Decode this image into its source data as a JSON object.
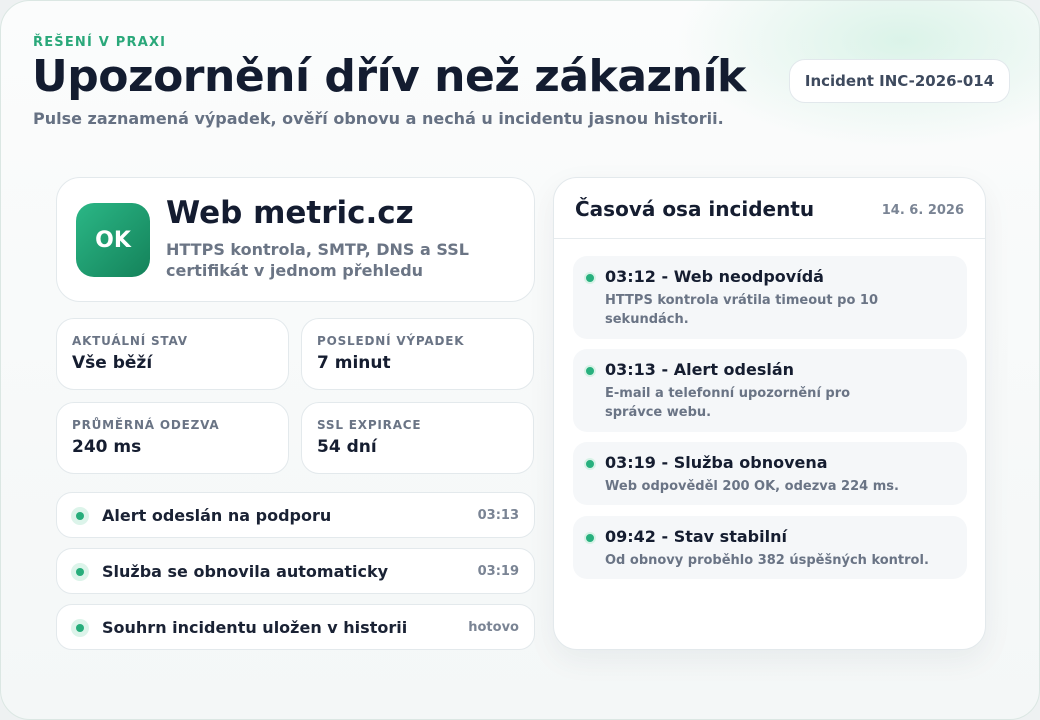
{
  "header": {
    "eyebrow": "ŘEŠENÍ V PRAXI",
    "title": "Upozornění dřív než zákazník",
    "subtitle": "Pulse zaznamená výpadek, ověří obnovu a nechá u incidentu jasnou historii.",
    "incident_id": "Incident INC-2026-014"
  },
  "site": {
    "badge": "OK",
    "name": "Web metric.cz",
    "description": "HTTPS kontrola, SMTP, DNS a SSL certifikát v jednom přehledu"
  },
  "stats": [
    {
      "label": "AKTUÁLNÍ STAV",
      "value": "Vše běží"
    },
    {
      "label": "POSLEDNÍ VÝPADEK",
      "value": "7 minut"
    },
    {
      "label": "PRŮMĚRNÁ ODEZVA",
      "value": "240 ms"
    },
    {
      "label": "SSL EXPIRACE",
      "value": "54 dní"
    }
  ],
  "events": [
    {
      "label": "Alert odeslán na podporu",
      "meta": "03:13"
    },
    {
      "label": "Služba se obnovila automaticky",
      "meta": "03:19"
    },
    {
      "label": "Souhrn incidentu uložen v historii",
      "meta": "hotovo"
    }
  ],
  "timeline": {
    "title": "Časová osa incidentu",
    "date": "14. 6. 2026",
    "items": [
      {
        "heading": "03:12 - Web neodpovídá",
        "text": "HTTPS kontrola vrátila timeout po 10 sekundách."
      },
      {
        "heading": "03:13 - Alert odeslán",
        "text": "E-mail a telefonní upozornění pro správce webu."
      },
      {
        "heading": "03:19 - Služba obnovena",
        "text": "Web odpověděl 200 OK, odezva 224 ms."
      },
      {
        "heading": "09:42 - Stav stabilní",
        "text": "Od obnovy proběhlo 382 úspěšných kontrol."
      }
    ]
  },
  "colors": {
    "accent": "#2aa87a",
    "ok_badge": "#1f9e6e",
    "dark_text": "#131c30",
    "muted_text": "#6a7485"
  }
}
